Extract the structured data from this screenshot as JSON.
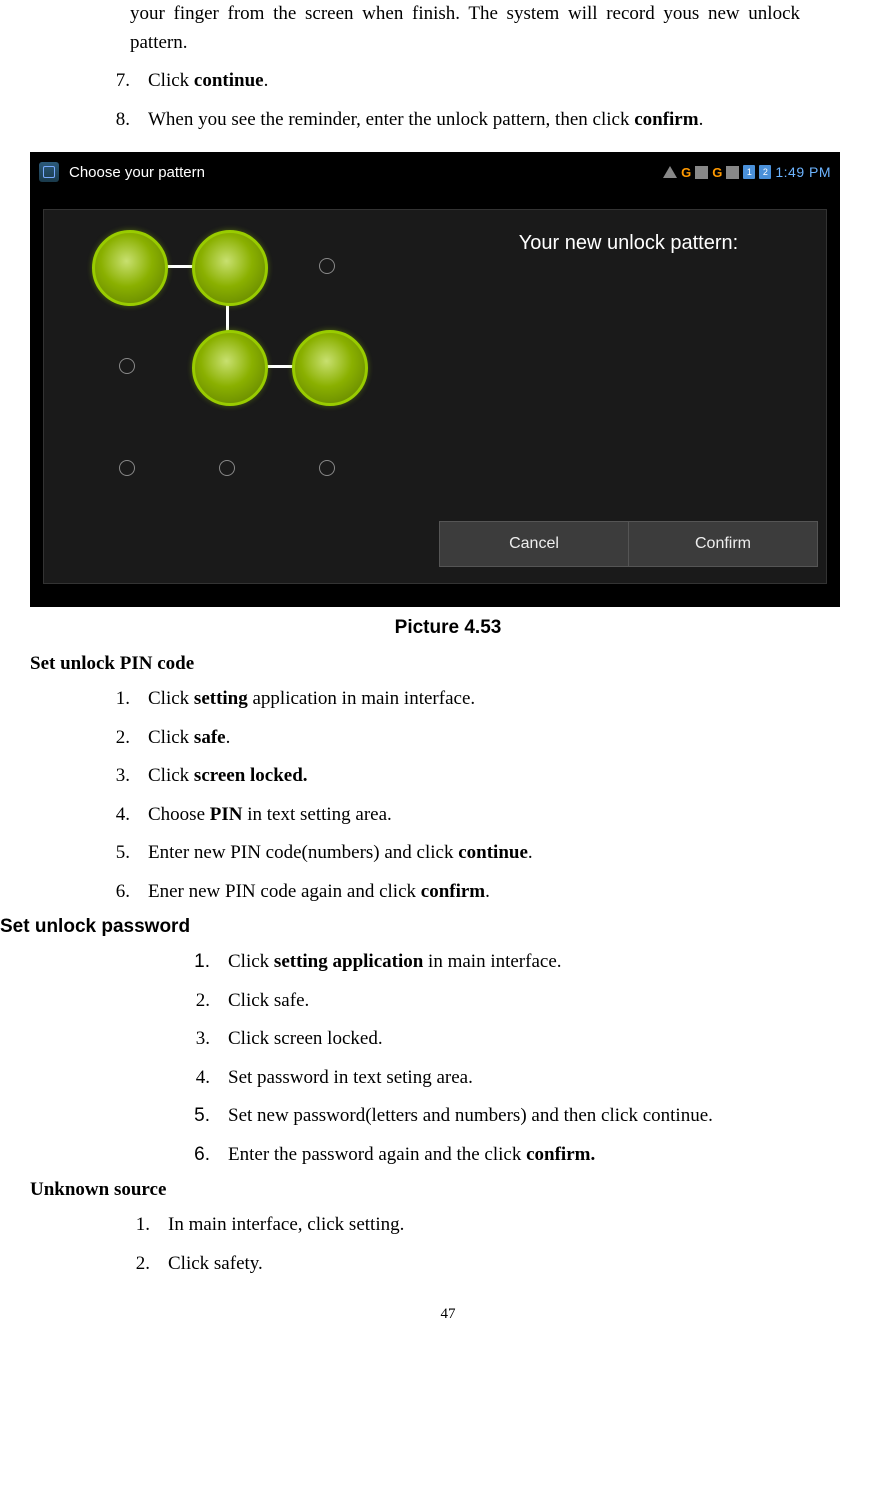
{
  "intro_fragment": "your finger from the screen when finish. The system will record yous new unlock pattern.",
  "top_list": [
    {
      "num": "7.",
      "pre": "Click ",
      "bold": "continue",
      "post": "."
    },
    {
      "num": "8.",
      "pre": "When you see the reminder, enter the unlock pattern, then click ",
      "bold": "confirm",
      "post": "."
    }
  ],
  "screenshot": {
    "title": "Choose your pattern",
    "status": {
      "g1": "G",
      "g2": "G",
      "sim1": "1",
      "sim2": "2",
      "time": "1:49 PM"
    },
    "prompt_pre": "Your new ",
    "prompt_bold": "unlock",
    "prompt_post": " pattern:",
    "cancel": "Cancel",
    "confirm": "Confirm"
  },
  "caption": "Picture 4.53",
  "section1_heading": "Set unlock PIN code",
  "section1": [
    {
      "num": "1.",
      "pre": "Click ",
      "bold": "setting",
      "post": " application in main interface."
    },
    {
      "num": "2.",
      "pre": "Click ",
      "bold": "safe",
      "post": "."
    },
    {
      "num": "3.",
      "pre": "Click ",
      "bold": "screen locked.",
      "post": ""
    },
    {
      "num": "4.",
      "pre": "Choose ",
      "bold": "PIN",
      "post": " in text setting area."
    },
    {
      "num": "5.",
      "pre": "Enter new PIN code(numbers) and click ",
      "bold": "continue",
      "post": "."
    },
    {
      "num": "6.",
      "pre": "Ener new PIN code again and click ",
      "bold": "confirm",
      "post": "."
    }
  ],
  "section2_heading": "Set unlock password",
  "section2": [
    {
      "num": "1.",
      "pre": "Click ",
      "bold": "setting application",
      "post": " in main interface."
    },
    {
      "num": "2.",
      "pre": "Click safe.",
      "bold": "",
      "post": ""
    },
    {
      "num": "3.",
      "pre": "Click screen locked.",
      "bold": "",
      "post": ""
    },
    {
      "num": "4.",
      "pre": "Set password in text seting area.",
      "bold": "",
      "post": ""
    },
    {
      "num": "5.",
      "pre": "Set new password(letters and numbers) and then click continue.",
      "bold": "",
      "post": ""
    },
    {
      "num": "6.",
      "pre": "Enter the password again and the click ",
      "bold": "confirm.",
      "post": ""
    }
  ],
  "section3_heading": "Unknown source",
  "section3": [
    {
      "num": "1.",
      "pre": "In main interface, click setting.",
      "bold": "",
      "post": ""
    },
    {
      "num": "2.",
      "pre": "Click safety.",
      "bold": "",
      "post": ""
    }
  ],
  "page_number": "47"
}
